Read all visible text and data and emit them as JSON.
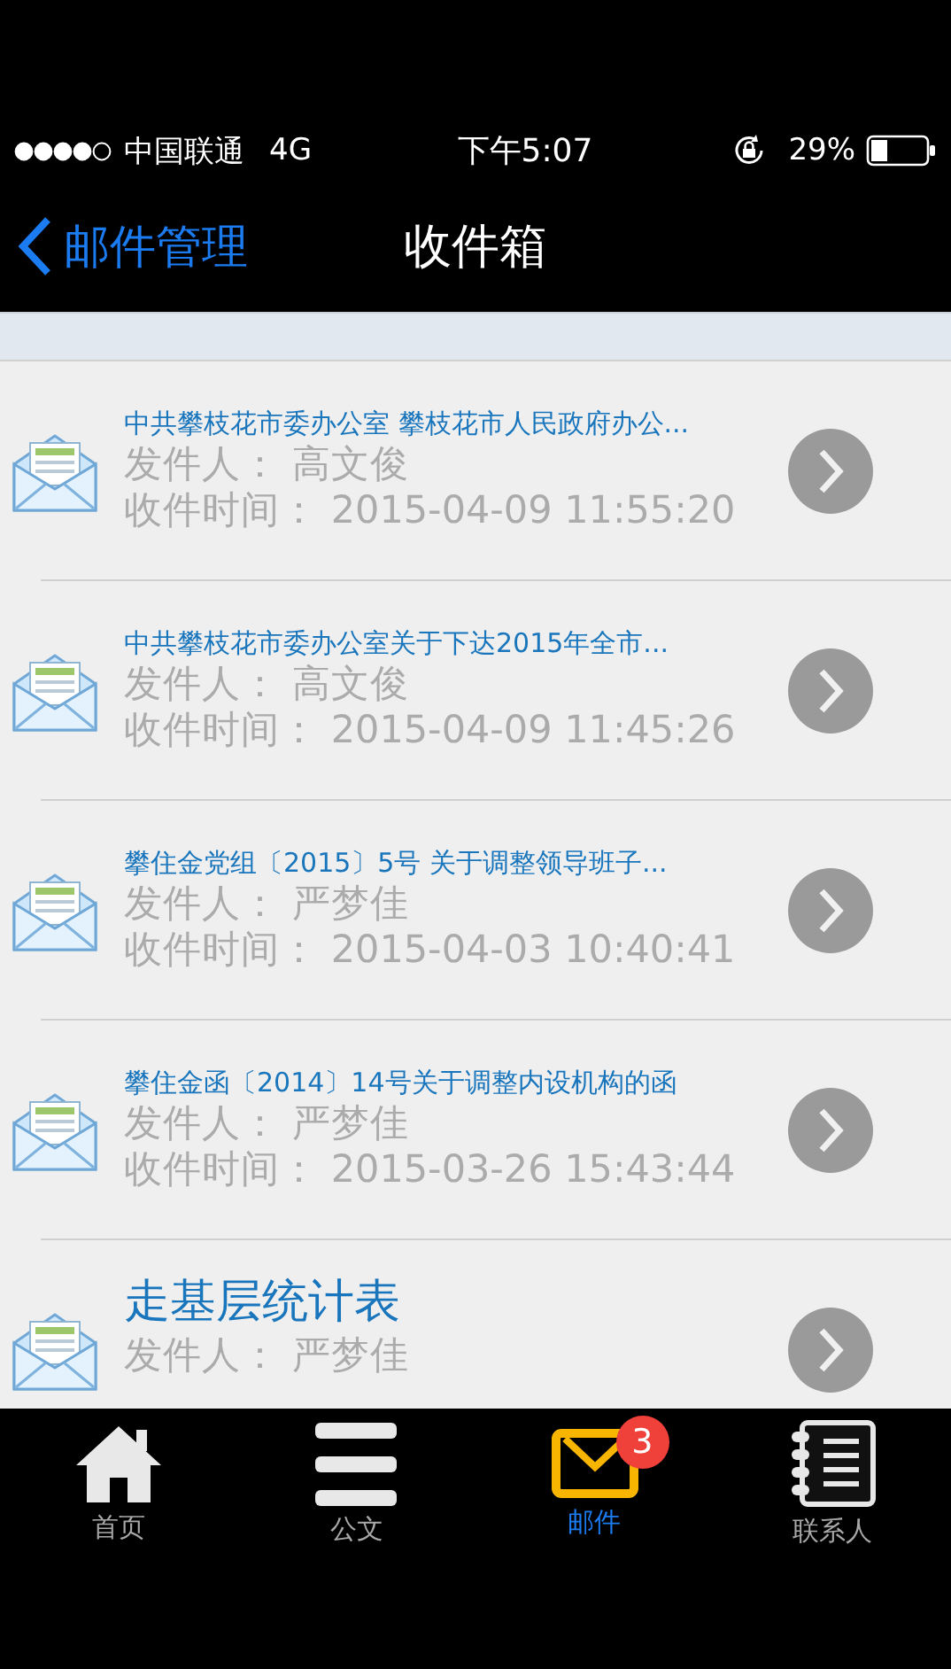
{
  "status_bar": {
    "carrier": "中国联通",
    "network": "4G",
    "time": "下午5:07",
    "battery": "29%"
  },
  "nav": {
    "back": "邮件管理",
    "title": "收件箱"
  },
  "mails": [
    {
      "title": "中共攀枝花市委办公室 攀枝花市人民政府办公...",
      "sender_label": "发件人：",
      "sender": "高文俊",
      "time_label": "收件时间：",
      "time": "2015-04-09 11:55:20"
    },
    {
      "title": "中共攀枝花市委办公室关于下达2015年全市...",
      "sender_label": "发件人：",
      "sender": "高文俊",
      "time_label": "收件时间：",
      "time": "2015-04-09 11:45:26"
    },
    {
      "title": "攀住金党组〔2015〕5号 关于调整领导班子...",
      "sender_label": "发件人：",
      "sender": "严梦佳",
      "time_label": "收件时间：",
      "time": "2015-04-03 10:40:41"
    },
    {
      "title": "攀住金函〔2014〕14号关于调整内设机构的函",
      "sender_label": "发件人：",
      "sender": "严梦佳",
      "time_label": "收件时间：",
      "time": "2015-03-26 15:43:44"
    },
    {
      "title": "走基层统计表",
      "sender_label": "发件人：",
      "sender": "严梦佳"
    }
  ],
  "tabs": [
    {
      "kind": "home",
      "label": "首页",
      "selected": false
    },
    {
      "kind": "docs",
      "label": "公文",
      "selected": false
    },
    {
      "kind": "mail",
      "label": "邮件",
      "selected": true,
      "badge": "3"
    },
    {
      "kind": "contacts",
      "label": "联系人",
      "selected": false
    }
  ]
}
